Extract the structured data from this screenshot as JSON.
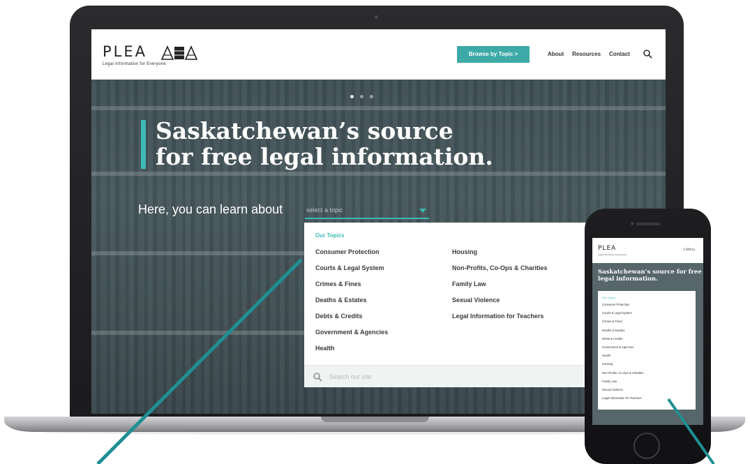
{
  "brand": {
    "name": "PLEA",
    "tagline": "Legal Information for Everyone",
    "accent": "#3daaa8"
  },
  "header": {
    "browse_button": "Browse by Topic  >",
    "nav": [
      "About",
      "Resources",
      "Contact"
    ]
  },
  "hero": {
    "headline_line1": "Saskatchewan’s source",
    "headline_line2": "for free legal information.",
    "learn_label": "Here, you can learn about",
    "select_placeholder": "select a topic"
  },
  "dropdown": {
    "heading": "Our Topics",
    "column1": [
      "Consumer Protection",
      "Courts & Legal System",
      "Crimes & Fines",
      "Deaths & Estates",
      "Debts & Credits",
      "Government & Agencies",
      "Health"
    ],
    "column2": [
      "Housing",
      "Non-Profits, Co-Ops & Charities",
      "Family Law",
      "Sexual Violence",
      "Legal Information for Teachers"
    ],
    "search_placeholder": "Search our site"
  },
  "mobile": {
    "logo": "PLEA",
    "menu_label": "≡  Menu",
    "headline": "Saskatchewan’s source for free legal information.",
    "dropdown_heading": "Our Topics",
    "topics": [
      "Consumer Protection",
      "Courts & Legal System",
      "Crimes & Fines",
      "Deaths & Estates",
      "Debts & Credits",
      "Government & Agencies",
      "Health",
      "Housing",
      "Non-Profits, Co-Ops & Charities",
      "Family Law",
      "Sexual Violence",
      "Legal Information for Teachers"
    ]
  }
}
